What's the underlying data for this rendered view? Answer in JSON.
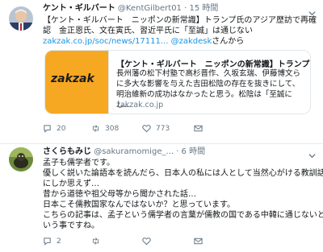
{
  "tweet1": {
    "name": "ケント・ギルバート",
    "handle": "@KentGilbert01",
    "time": "· 15 時間",
    "lines": [
      "【ケント・ギルバート　ニッポンの新常識】トランプ氏のアジア歴訪で再確",
      "認　金正恩氏、文在寅氏、習近平氏に「至誠」は通じない"
    ],
    "link_url": "zakzak.co.jp/soc/news/17111...",
    "mention": "@zakdesk",
    "mention_suffix": "さんから",
    "card": {
      "logo": "zakzak",
      "title": "【ケント・ギルバート　ニッポンの新常識】トランプ...",
      "desc": "長州藩の松下村塾で高杉晋作、久坂玄瑞、伊藤博文らに多大な影響を与えた吉田松陰の存在を抜きにして、明治維新の成功はなかったと思う。松陰は「至誠にし...",
      "domain": "zakzak.co.jp"
    },
    "actions": {
      "reply": "20",
      "retweet": "308",
      "like": "773"
    }
  },
  "tweet2": {
    "name": "さくらもみじ",
    "handle": "@sakuramomige_...",
    "time": "· 6 時間",
    "lines": [
      "孟子も儒学者です。",
      "優しく説いた論語本を読んだら、日本人の私には人として当然心がける教訓話",
      "にしか思えず…",
      "昔から道徳や祖父母等から聞かされた話…",
      "日本こそ儒教国家なんではないか？と思っています。",
      "こちらの記事は、孟子という儒学者の言葉が儒教の国である中韓に通じないと",
      "いう事ですね。"
    ],
    "actions": {
      "reply": "2",
      "retweet": "",
      "like": ""
    }
  },
  "colors": {
    "link": "#1b95e0",
    "muted": "#657786",
    "card_image": "#f7a823"
  }
}
